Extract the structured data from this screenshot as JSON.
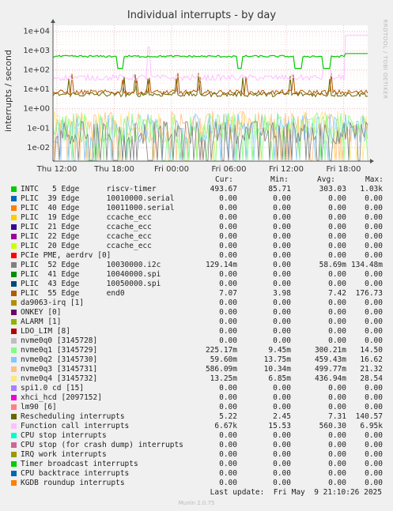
{
  "chart_data": {
    "type": "line",
    "title": "Individual interrupts - by day",
    "ylabel": "interrupts / second",
    "yscale": "log",
    "ylim": [
      0.002,
      20000
    ],
    "yticks": [
      {
        "value": 10000,
        "label": "1e+04"
      },
      {
        "value": 1000,
        "label": "1e+03"
      },
      {
        "value": 100,
        "label": "1e+02"
      },
      {
        "value": 10,
        "label": "1e+01"
      },
      {
        "value": 1,
        "label": "1e+00"
      },
      {
        "value": 0.1,
        "label": "1e-01"
      },
      {
        "value": 0.01,
        "label": "1e-02"
      }
    ],
    "xticks": [
      "Thu 12:00",
      "Thu 18:00",
      "Fri 00:00",
      "Fri 06:00",
      "Fri 12:00",
      "Fri 18:00"
    ],
    "grid": true,
    "side_credit": "RRDTOOL / TOBI OETIKER"
  },
  "legend": {
    "headers": {
      "cur": "Cur:",
      "min": "Min:",
      "avg": "Avg:",
      "max": "Max:"
    },
    "rows": [
      {
        "label": "INTC   5 Edge      riscv-timer",
        "color": "#00cc00",
        "cur": "493.67",
        "min": "85.71",
        "avg": "303.03",
        "max": "1.03k"
      },
      {
        "label": "PLIC  39 Edge      10010000.serial",
        "color": "#0066b3",
        "cur": "0.00",
        "min": "0.00",
        "avg": "0.00",
        "max": "0.00"
      },
      {
        "label": "PLIC  40 Edge      10011000.serial",
        "color": "#ff8000",
        "cur": "0.00",
        "min": "0.00",
        "avg": "0.00",
        "max": "0.00"
      },
      {
        "label": "PLIC  19 Edge      ccache_ecc",
        "color": "#ffcc00",
        "cur": "0.00",
        "min": "0.00",
        "avg": "0.00",
        "max": "0.00"
      },
      {
        "label": "PLIC  21 Edge      ccache_ecc",
        "color": "#330099",
        "cur": "0.00",
        "min": "0.00",
        "avg": "0.00",
        "max": "0.00"
      },
      {
        "label": "PLIC  22 Edge      ccache_ecc",
        "color": "#990099",
        "cur": "0.00",
        "min": "0.00",
        "avg": "0.00",
        "max": "0.00"
      },
      {
        "label": "PLIC  20 Edge      ccache_ecc",
        "color": "#ccff00",
        "cur": "0.00",
        "min": "0.00",
        "avg": "0.00",
        "max": "0.00"
      },
      {
        "label": "PCIe PME, aerdrv [0]",
        "color": "#ff0000",
        "cur": "0.00",
        "min": "0.00",
        "avg": "0.00",
        "max": "0.00"
      },
      {
        "label": "PLIC  52 Edge      10030000.i2c",
        "color": "#808080",
        "cur": "129.14m",
        "min": "0.00",
        "avg": "58.69m",
        "max": "134.48m"
      },
      {
        "label": "PLIC  41 Edge      10040000.spi",
        "color": "#008f00",
        "cur": "0.00",
        "min": "0.00",
        "avg": "0.00",
        "max": "0.00"
      },
      {
        "label": "PLIC  43 Edge      10050000.spi",
        "color": "#00487d",
        "cur": "0.00",
        "min": "0.00",
        "avg": "0.00",
        "max": "0.00"
      },
      {
        "label": "PLIC  55 Edge      end0",
        "color": "#b35a00",
        "cur": "7.07",
        "min": "3.98",
        "avg": "7.42",
        "max": "176.73"
      },
      {
        "label": "da9063-irq [1]",
        "color": "#b38f00",
        "cur": "0.00",
        "min": "0.00",
        "avg": "0.00",
        "max": "0.00"
      },
      {
        "label": "ONKEY [0]",
        "color": "#6b006b",
        "cur": "0.00",
        "min": "0.00",
        "avg": "0.00",
        "max": "0.00"
      },
      {
        "label": "ALARM [1]",
        "color": "#8fb300",
        "cur": "0.00",
        "min": "0.00",
        "avg": "0.00",
        "max": "0.00"
      },
      {
        "label": "LDO_LIM [8]",
        "color": "#b30000",
        "cur": "0.00",
        "min": "0.00",
        "avg": "0.00",
        "max": "0.00"
      },
      {
        "label": "nvme0q0 [3145728]",
        "color": "#bebebe",
        "cur": "0.00",
        "min": "0.00",
        "avg": "0.00",
        "max": "0.00"
      },
      {
        "label": "nvme0q1 [3145729]",
        "color": "#80ff80",
        "cur": "225.17m",
        "min": "9.45m",
        "avg": "300.21m",
        "max": "14.50"
      },
      {
        "label": "nvme0q2 [3145730]",
        "color": "#80c9ff",
        "cur": "59.60m",
        "min": "13.75m",
        "avg": "459.43m",
        "max": "16.62"
      },
      {
        "label": "nvme0q3 [3145731]",
        "color": "#ffc080",
        "cur": "586.09m",
        "min": "10.34m",
        "avg": "499.77m",
        "max": "21.32"
      },
      {
        "label": "nvme0q4 [3145732]",
        "color": "#ffe680",
        "cur": "13.25m",
        "min": "6.85m",
        "avg": "436.94m",
        "max": "28.54"
      },
      {
        "label": "spi1.0 cd [15]",
        "color": "#aa80ff",
        "cur": "0.00",
        "min": "0.00",
        "avg": "0.00",
        "max": "0.00"
      },
      {
        "label": "xhci_hcd [2097152]",
        "color": "#ee00cc",
        "cur": "0.00",
        "min": "0.00",
        "avg": "0.00",
        "max": "0.00"
      },
      {
        "label": "lm90 [6]",
        "color": "#ff8080",
        "cur": "0.00",
        "min": "0.00",
        "avg": "0.00",
        "max": "0.00"
      },
      {
        "label": "Rescheduling interrupts",
        "color": "#666600",
        "cur": "5.22",
        "min": "2.45",
        "avg": "7.31",
        "max": "140.57"
      },
      {
        "label": "Function call interrupts",
        "color": "#ffbfff",
        "cur": "6.67k",
        "min": "15.53",
        "avg": "560.30",
        "max": "6.95k"
      },
      {
        "label": "CPU stop interrupts",
        "color": "#00ffcc",
        "cur": "0.00",
        "min": "0.00",
        "avg": "0.00",
        "max": "0.00"
      },
      {
        "label": "CPU stop (for crash dump) interrupts",
        "color": "#cc6699",
        "cur": "0.00",
        "min": "0.00",
        "avg": "0.00",
        "max": "0.00"
      },
      {
        "label": "IRQ work interrupts",
        "color": "#999900",
        "cur": "0.00",
        "min": "0.00",
        "avg": "0.00",
        "max": "0.00"
      },
      {
        "label": "Timer broadcast interrupts",
        "color": "#00cc00",
        "cur": "0.00",
        "min": "0.00",
        "avg": "0.00",
        "max": "0.00"
      },
      {
        "label": "CPU backtrace interrupts",
        "color": "#0066b3",
        "cur": "0.00",
        "min": "0.00",
        "avg": "0.00",
        "max": "0.00"
      },
      {
        "label": "KGDB roundup interrupts",
        "color": "#ff8000",
        "cur": "0.00",
        "min": "0.00",
        "avg": "0.00",
        "max": "0.00"
      }
    ]
  },
  "footer": {
    "last_update": "Last update:  Fri May  9 21:10:26 2025",
    "version": "Munin 2.0.75"
  }
}
